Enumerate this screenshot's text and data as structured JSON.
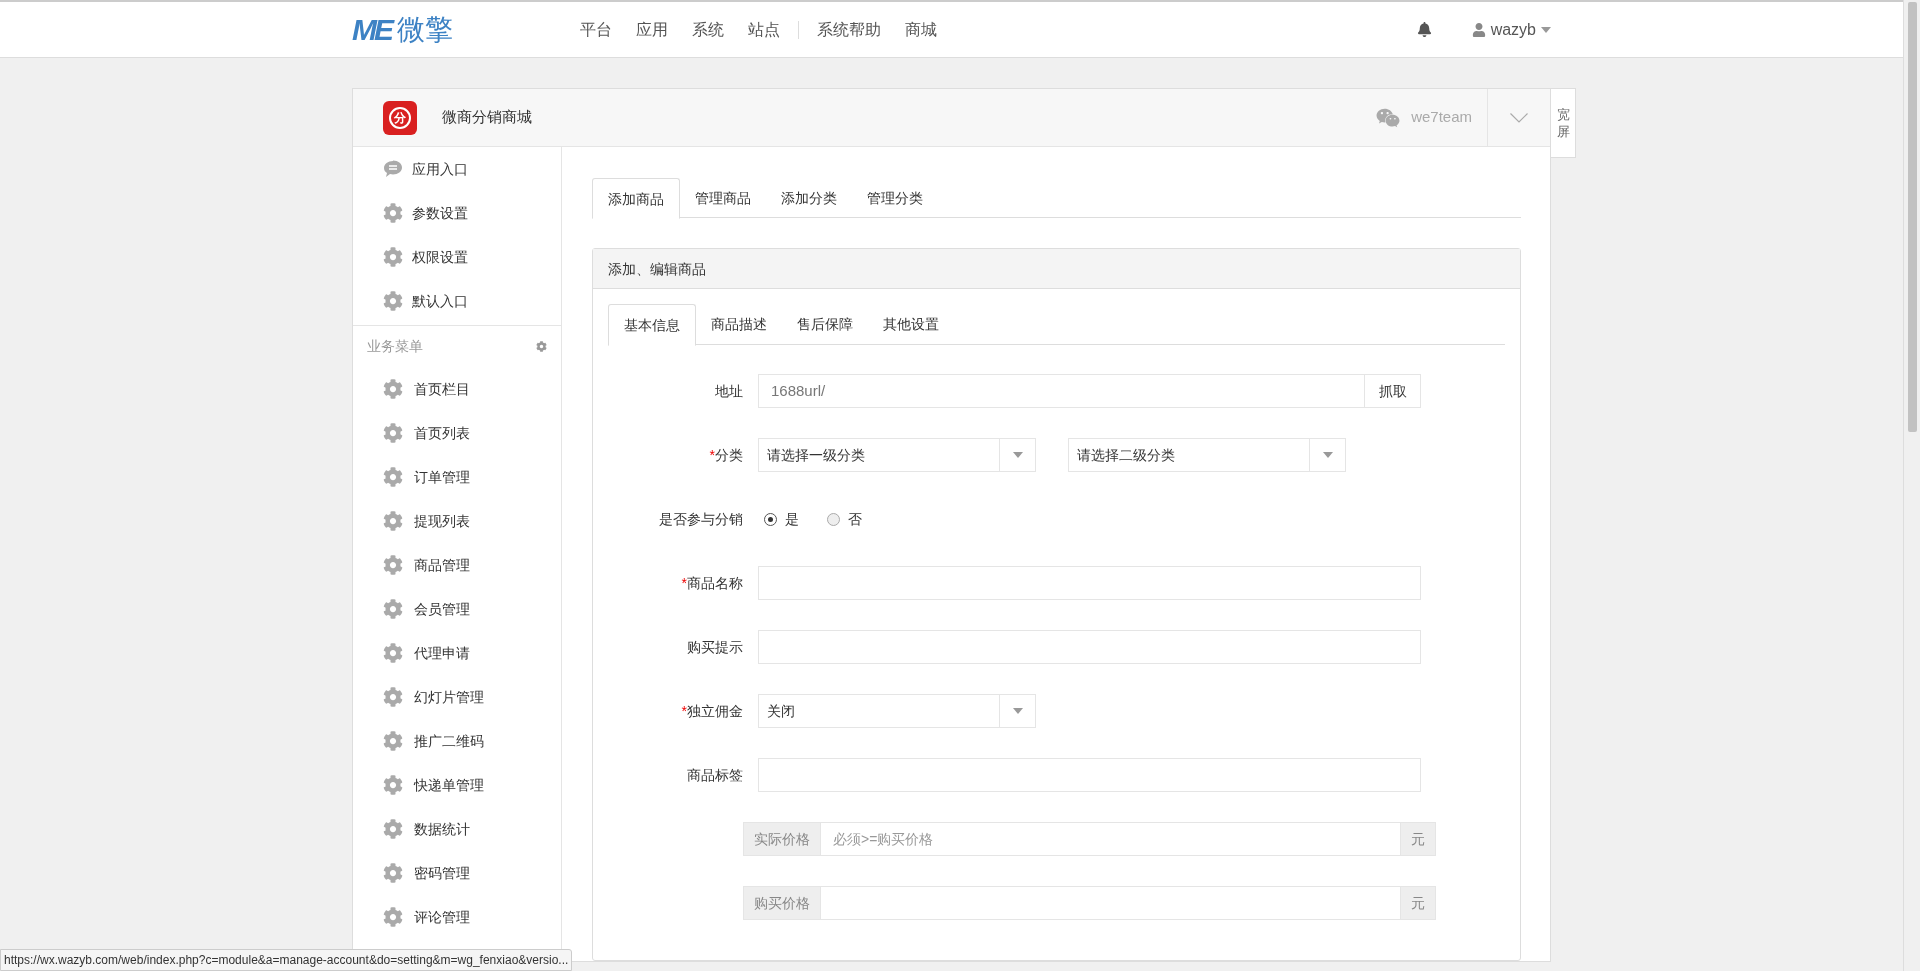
{
  "topbar": {
    "logo_mark": "ME",
    "logo_name": "微擎",
    "nav_groups": [
      [
        "平台",
        "应用",
        "系统",
        "站点"
      ],
      [
        "系统帮助",
        "商城"
      ]
    ],
    "user": "wazyb"
  },
  "app": {
    "icon_text": "分",
    "title": "微商分销商城",
    "account": "we7team",
    "wide_button": "宽屏"
  },
  "sidebar": {
    "top_items": [
      {
        "label": "应用入口",
        "kind": "chat"
      },
      {
        "label": "参数设置",
        "kind": "gear"
      },
      {
        "label": "权限设置",
        "kind": "gear"
      },
      {
        "label": "默认入口",
        "kind": "gear"
      }
    ],
    "section_title": "业务菜单",
    "business_items": [
      "首页栏目",
      "首页列表",
      "订单管理",
      "提现列表",
      "商品管理",
      "会员管理",
      "代理申请",
      "幻灯片管理",
      "推广二维码",
      "快递单管理",
      "数据统计",
      "密码管理",
      "评论管理"
    ]
  },
  "tabs": [
    {
      "label": "添加商品",
      "selected": true
    },
    {
      "label": "管理商品",
      "selected": false
    },
    {
      "label": "添加分类",
      "selected": false
    },
    {
      "label": "管理分类",
      "selected": false
    }
  ],
  "panel": {
    "title": "添加、编辑商品",
    "tabs": [
      {
        "label": "基本信息",
        "selected": true
      },
      {
        "label": "商品描述",
        "selected": false
      },
      {
        "label": "售后保障",
        "selected": false
      },
      {
        "label": "其他设置",
        "selected": false
      }
    ],
    "fields": [
      {
        "kind": "url",
        "label": "地址",
        "value": "1688url/",
        "button": "抓取"
      },
      {
        "kind": "selects",
        "label": "分类",
        "required_mark": "*",
        "options": [
          "请选择一级分类",
          "请选择二级分类"
        ]
      },
      {
        "kind": "radio",
        "label": "是否参与分销",
        "options": [
          {
            "label": "是",
            "selected": true
          },
          {
            "label": "否",
            "selected": false
          }
        ]
      },
      {
        "kind": "text",
        "label": "商品名称",
        "required_mark": "*"
      },
      {
        "kind": "text",
        "label": "购买提示"
      },
      {
        "kind": "select",
        "label": "独立佣金",
        "required_mark": "*",
        "value": "关闭"
      },
      {
        "kind": "text",
        "label": "商品标签"
      },
      {
        "kind": "price",
        "addon": "实际价格",
        "placeholder": "必须>=购买价格",
        "suffix": "元"
      },
      {
        "kind": "price",
        "addon": "购买价格",
        "suffix": "元"
      }
    ]
  },
  "status_url": "https://wx.wazyb.com/web/index.php?c=module&a=manage-account&do=setting&m=wg_fenxiao&versio..."
}
